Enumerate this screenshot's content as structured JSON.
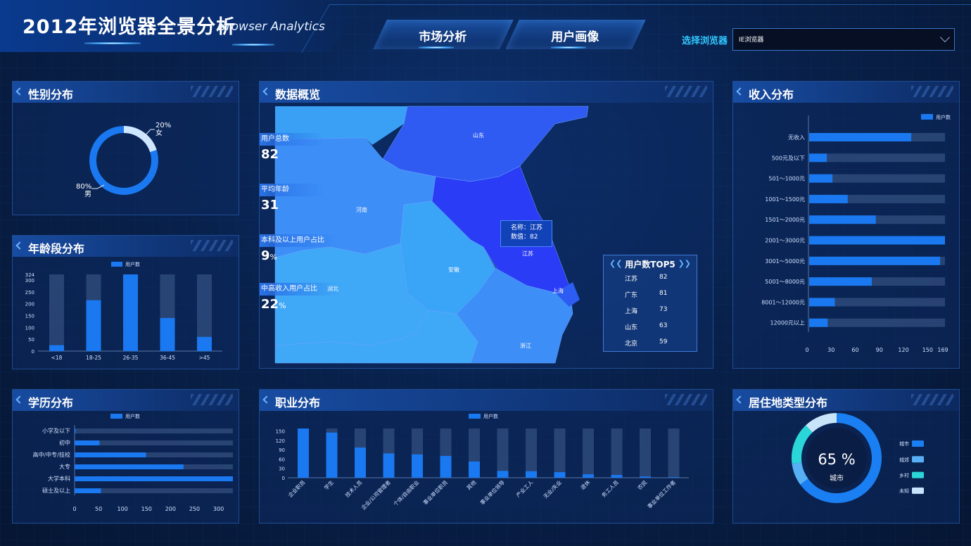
{
  "header": {
    "title": "2012年浏览器全景分析",
    "subtitle": "Browser Analytics",
    "tabs": [
      {
        "label": "市场分析"
      },
      {
        "label": "用户画像"
      }
    ],
    "browser_select": {
      "label": "选择浏览器",
      "value": "IE浏览器"
    }
  },
  "gender": {
    "title": "性别分布",
    "slices": [
      {
        "name": "女",
        "percent": "20%",
        "value": 20,
        "color": "#cfe6ff"
      },
      {
        "name": "男",
        "percent": "80%",
        "value": 80,
        "color": "#1a78f0"
      }
    ]
  },
  "age": {
    "title": "年龄段分布",
    "legend": "用户数",
    "chart_data": {
      "type": "bar",
      "categories": [
        "<18",
        "18-25",
        "26-35",
        "36-45",
        ">45"
      ],
      "values": [
        25,
        215,
        324,
        140,
        60
      ],
      "max": 324,
      "yticks": [
        "0",
        "50",
        "100",
        "150",
        "200",
        "250",
        "300",
        "324"
      ]
    }
  },
  "education": {
    "title": "学历分布",
    "legend": "用户数",
    "chart_data": {
      "type": "bar",
      "orientation": "horizontal",
      "categories": [
        "小学及以下",
        "初中",
        "高中/中专/技校",
        "大专",
        "大学本科",
        "硕士及以上"
      ],
      "values": [
        2,
        52,
        149,
        227,
        330,
        55
      ],
      "max": 330,
      "xticks": [
        "0",
        "50",
        "100",
        "150",
        "200",
        "250",
        "300"
      ]
    }
  },
  "overview": {
    "title": "数据概览",
    "stats": [
      {
        "label": "用户总数",
        "value": "82",
        "unit": ""
      },
      {
        "label": "平均年龄",
        "value": "31",
        "unit": ""
      },
      {
        "label": "本科及以上用户占比",
        "value": "9",
        "unit": "%"
      },
      {
        "label": "中高收入用户占比",
        "value": "22",
        "unit": "%"
      }
    ],
    "map_labels": [
      "山东",
      "河南",
      "江苏",
      "安徽",
      "上海",
      "浙江",
      "湖北"
    ],
    "tooltip": {
      "name_line": "名称：江苏",
      "value_line": "数值：82"
    },
    "top5": {
      "title": "用户数TOP5",
      "rows": [
        {
          "name": "江苏",
          "value": "82"
        },
        {
          "name": "广东",
          "value": "81"
        },
        {
          "name": "上海",
          "value": "73"
        },
        {
          "name": "山东",
          "value": "63"
        },
        {
          "name": "北京",
          "value": "59"
        }
      ]
    }
  },
  "occupation": {
    "title": "职业分布",
    "legend": "用户数",
    "chart_data": {
      "type": "bar",
      "categories": [
        "企业职员",
        "学生",
        "技术人员",
        "企业/公司管理者",
        "个体/自由职业",
        "事业单位职员",
        "其他",
        "事业单位领导",
        "产业工人",
        "无业/失业",
        "退休",
        "务工人员",
        "农民",
        "事业单位工作者"
      ],
      "values": [
        158,
        145,
        97,
        78,
        75,
        70,
        52,
        22,
        21,
        18,
        11,
        9,
        4,
        2
      ],
      "max": 158,
      "yticks": [
        "0",
        "30",
        "60",
        "90",
        "120",
        "150"
      ]
    }
  },
  "income": {
    "title": "收入分布",
    "legend": "用户数",
    "chart_data": {
      "type": "bar",
      "orientation": "horizontal",
      "categories": [
        "无收入",
        "500元及以下",
        "501～1000元",
        "1001～1500元",
        "1501～2000元",
        "2001～3000元",
        "3001～5000元",
        "5001～8000元",
        "8001～12000元",
        "12000元以上"
      ],
      "values": [
        127,
        22,
        29,
        48,
        83,
        169,
        163,
        78,
        32,
        23
      ],
      "max": 169,
      "xticks": [
        "0",
        "30",
        "60",
        "90",
        "120",
        "150",
        "169"
      ]
    }
  },
  "residence": {
    "title": "居住地类型分布",
    "center_value": "65 %",
    "center_label": "城市",
    "slices": [
      {
        "name": "城市",
        "value": 65,
        "color": "#1a7ff2"
      },
      {
        "name": "城郊",
        "value": 8,
        "color": "#57b0f5"
      },
      {
        "name": "乡村",
        "value": 15,
        "color": "#2bd6d9"
      },
      {
        "name": "未知",
        "value": 12,
        "color": "#c8e4fb"
      }
    ]
  }
}
